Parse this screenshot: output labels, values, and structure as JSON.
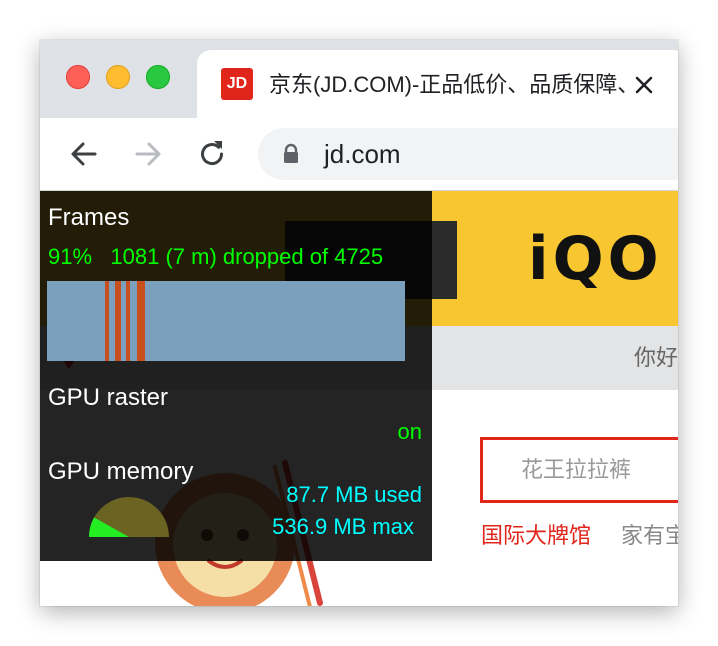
{
  "browser": {
    "tab": {
      "favicon_text": "JD",
      "title": "京东(JD.COM)-正品低价、品质保障、配送及时、轻松购物！"
    },
    "address_bar": {
      "url": "jd.com"
    }
  },
  "page": {
    "banner": {
      "logo_text": "iQO"
    },
    "greeting": "你好",
    "search": {
      "placeholder": "花王拉拉裤"
    },
    "hot_links": [
      "国际大牌馆",
      "家有宝"
    ]
  },
  "perf_hud": {
    "frames": {
      "label": "Frames",
      "percent": "91%",
      "dropped_summary": "1081 (7 m) dropped of 4725",
      "dropped_fraction": 0.2288
    },
    "gpu_raster": {
      "label": "GPU raster",
      "state": "on"
    },
    "gpu_memory": {
      "label": "GPU memory",
      "used": "87.7 MB used",
      "max": "536.9 MB max",
      "used_fraction": 0.163
    }
  },
  "colors": {
    "jd_red": "#e1251b",
    "banner_yellow": "#f7c631",
    "hud_green": "#00ff00",
    "hud_cyan": "#00ffff",
    "graph_fill": "#7aa0be",
    "graph_drop": "#c8501e"
  },
  "icons": {
    "back": "arrow-left",
    "forward": "arrow-right",
    "reload": "circular-arrow",
    "lock": "padlock",
    "close": "x-mark",
    "location": "map-pin"
  }
}
